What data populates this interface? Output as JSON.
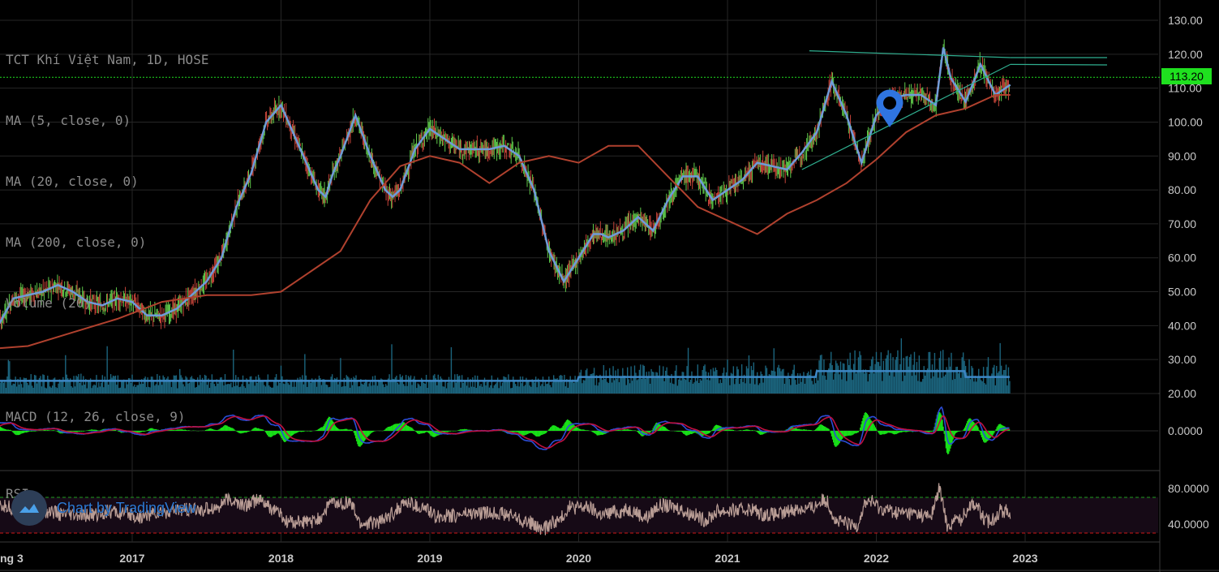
{
  "legend": {
    "title": "TCT Khí Việt Nam, 1D, HOSE",
    "ma5": "MA (5, close, 0)",
    "ma20": "MA (20, close, 0)",
    "ma200": "MA (200, close, 0)",
    "volume": "Volume (20)",
    "macd": "MACD (12, 26, close, 9)",
    "rsi": "RSI"
  },
  "last_price_label": "113.20",
  "watermark": "Chart by TradingView",
  "colors": {
    "up": "#5fc94a",
    "down": "#c8453a",
    "ma5": "#6f9bd8",
    "ma200": "#b0412e",
    "volume": "#1f6f8b",
    "macd": "#2b4cd6",
    "signal": "#c01040",
    "hist": "#18e018",
    "rsi": "#b89c94",
    "trendline": "#2fae8f",
    "price_line": "#1fe01f"
  },
  "chart_data": [
    {
      "type": "line",
      "title": "TCT Khí Việt Nam, 1D, HOSE",
      "x_ticks": [
        "ng 3",
        "2017",
        "2018",
        "2019",
        "2020",
        "2021",
        "2022",
        "2023"
      ],
      "x_tick_dates": [
        2016.17,
        2017.0,
        2018.0,
        2019.0,
        2020.0,
        2021.0,
        2022.0,
        2023.0
      ],
      "y_ticks": [
        "130.00",
        "120.00",
        "110.00",
        "100.00",
        "90.00",
        "80.00",
        "70.00",
        "60.00",
        "50.00",
        "40.00",
        "30.00",
        "20.00"
      ],
      "ylim": [
        20,
        130
      ],
      "last_price": 113.2,
      "series": [
        {
          "name": "MA (5, close, 0)",
          "x": [
            2016.0,
            2016.1,
            2016.2,
            2016.3,
            2016.4,
            2016.5,
            2016.6,
            2016.7,
            2016.8,
            2016.9,
            2017.0,
            2017.1,
            2017.2,
            2017.3,
            2017.4,
            2017.5,
            2017.6,
            2017.7,
            2017.8,
            2017.9,
            2018.0,
            2018.1,
            2018.2,
            2018.25,
            2018.3,
            2018.35,
            2018.4,
            2018.5,
            2018.6,
            2018.7,
            2018.75,
            2018.8,
            2018.9,
            2019.0,
            2019.1,
            2019.2,
            2019.3,
            2019.4,
            2019.5,
            2019.6,
            2019.7,
            2019.8,
            2019.9,
            2020.0,
            2020.1,
            2020.15,
            2020.2,
            2020.3,
            2020.4,
            2020.5,
            2020.6,
            2020.7,
            2020.8,
            2020.9,
            2021.0,
            2021.1,
            2021.2,
            2021.3,
            2021.4,
            2021.5,
            2021.6,
            2021.7,
            2021.8,
            2021.85,
            2021.9,
            2022.0,
            2022.1,
            2022.2,
            2022.3,
            2022.4,
            2022.45,
            2022.5,
            2022.6,
            2022.7,
            2022.8,
            2022.9
          ],
          "y": [
            33,
            40,
            48,
            49,
            50,
            52,
            50,
            47,
            46,
            48,
            47,
            43,
            43,
            45,
            49,
            53,
            60,
            75,
            85,
            100,
            105,
            95,
            85,
            80,
            78,
            85,
            90,
            102,
            90,
            80,
            78,
            80,
            92,
            98,
            95,
            92,
            92,
            92,
            93,
            90,
            80,
            62,
            53,
            60,
            67,
            67,
            66,
            68,
            72,
            68,
            77,
            84,
            84,
            77,
            80,
            83,
            88,
            87,
            86,
            91,
            97,
            112,
            102,
            95,
            88,
            102,
            107,
            108,
            108,
            105,
            122,
            113,
            106,
            117,
            108,
            111
          ]
        },
        {
          "name": "MA (200, close, 0)",
          "x": [
            2016.0,
            2016.3,
            2016.6,
            2016.9,
            2017.2,
            2017.5,
            2017.8,
            2018.0,
            2018.2,
            2018.4,
            2018.6,
            2018.8,
            2019.0,
            2019.2,
            2019.4,
            2019.6,
            2019.8,
            2020.0,
            2020.2,
            2020.4,
            2020.6,
            2020.8,
            2021.0,
            2021.2,
            2021.4,
            2021.6,
            2021.8,
            2022.0,
            2022.2,
            2022.4,
            2022.6,
            2022.8,
            2022.9
          ],
          "y": [
            33,
            34,
            38,
            42,
            47,
            49,
            49,
            50,
            56,
            62,
            77,
            87,
            90,
            88,
            82,
            88,
            90,
            88,
            93,
            93,
            84,
            75,
            71,
            67,
            73,
            77,
            82,
            89,
            97,
            102,
            104,
            108,
            108
          ]
        },
        {
          "name": "Trendline upper",
          "x": [
            2021.55,
            2022.9
          ],
          "y": [
            121,
            119
          ]
        },
        {
          "name": "Trendline lower",
          "x": [
            2021.5,
            2022.9
          ],
          "y": [
            86,
            117
          ]
        }
      ]
    },
    {
      "type": "bar",
      "title": "Volume (20)",
      "note": "histogram under price pane"
    },
    {
      "type": "line",
      "title": "MACD (12, 26, close, 9)",
      "y_ticks": [
        "0.0000"
      ],
      "ylim": [
        -10,
        10
      ]
    },
    {
      "type": "line",
      "title": "RSI",
      "y_ticks": [
        "80.0000",
        "40.0000"
      ],
      "ylim": [
        20,
        90
      ],
      "levels": [
        70,
        30
      ]
    }
  ]
}
